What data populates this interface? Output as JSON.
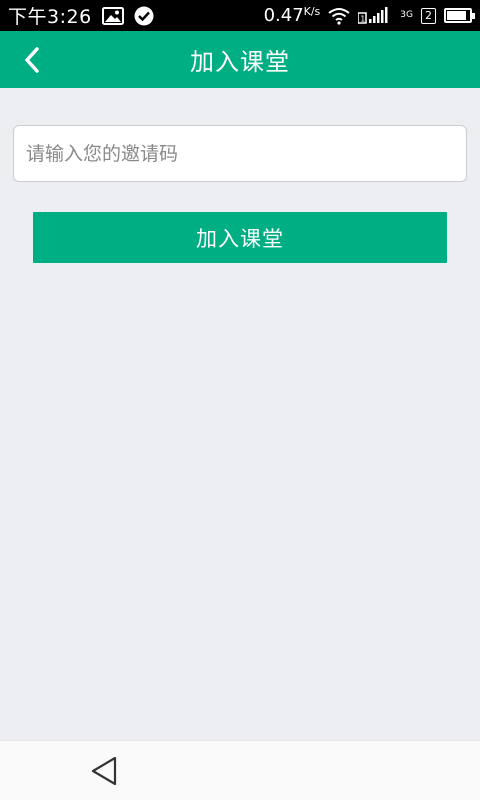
{
  "status_bar": {
    "time": "下午3:26",
    "net_speed": "0.47",
    "net_speed_unit": "K/s",
    "sim_slot": "2",
    "network_type": "3G",
    "battery_percent": 85
  },
  "app_bar": {
    "title": "加入课堂"
  },
  "form": {
    "invite_placeholder": "请输入您的邀请码",
    "invite_value": "",
    "submit_label": "加入课堂"
  },
  "colors": {
    "brand": "#00ae84",
    "background": "#eceef2"
  }
}
